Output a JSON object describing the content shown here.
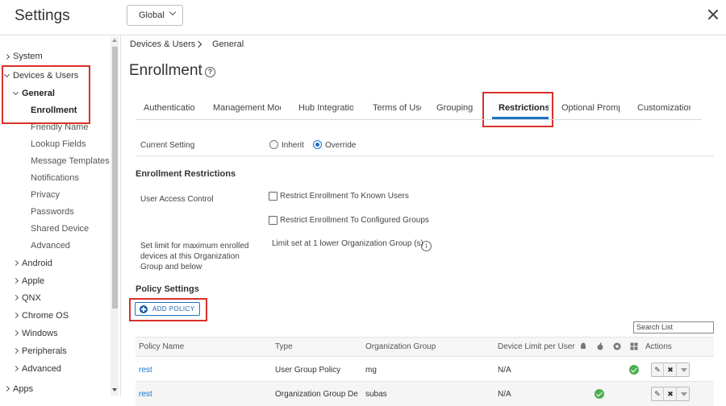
{
  "app": {
    "title": "Settings",
    "scope": "Global"
  },
  "sidebar": {
    "items": [
      {
        "label": "System"
      },
      {
        "label": "Devices & Users"
      },
      {
        "label": "General"
      },
      {
        "label": "Enrollment"
      },
      {
        "label": "Friendly Name"
      },
      {
        "label": "Lookup Fields"
      },
      {
        "label": "Message Templates"
      },
      {
        "label": "Notifications"
      },
      {
        "label": "Privacy"
      },
      {
        "label": "Passwords"
      },
      {
        "label": "Shared Device"
      },
      {
        "label": "Advanced"
      },
      {
        "label": "Android"
      },
      {
        "label": "Apple"
      },
      {
        "label": "QNX"
      },
      {
        "label": "Chrome OS"
      },
      {
        "label": "Windows"
      },
      {
        "label": "Peripherals"
      },
      {
        "label": "Advanced"
      },
      {
        "label": "Apps"
      }
    ]
  },
  "breadcrumb": {
    "parent": "Devices & Users",
    "current": "General"
  },
  "page": {
    "title": "Enrollment",
    "help_icon": "?"
  },
  "tabs": [
    {
      "label": "Authentication"
    },
    {
      "label": "Management Mode"
    },
    {
      "label": "Hub Integration"
    },
    {
      "label": "Terms of Use"
    },
    {
      "label": "Grouping"
    },
    {
      "label": "Restrictions"
    },
    {
      "label": "Optional Prompt"
    },
    {
      "label": "Customization"
    }
  ],
  "form": {
    "current_setting_label": "Current Setting",
    "inherit_label": "Inherit",
    "override_label": "Override",
    "selected": "Override",
    "enrollment_restrictions_heading": "Enrollment Restrictions",
    "user_access_control_label": "User Access Control",
    "restrict_known_users": "Restrict Enrollment To Known Users",
    "restrict_configured_groups": "Restrict Enrollment To Configured Groups",
    "limit_label_line1": "Set limit for maximum enrolled",
    "limit_label_line2": "devices at this Organization",
    "limit_label_line3": "Group and below",
    "limit_value": "Limit set at 1 lower Organization Group (s)",
    "info_icon": "i"
  },
  "policy": {
    "heading": "Policy Settings",
    "add_button": "ADD POLICY",
    "search_placeholder": "Search List",
    "columns": {
      "name": "Policy Name",
      "type": "Type",
      "org_group": "Organization Group",
      "device_limit": "Device Limit per User",
      "actions": "Actions"
    },
    "rows": [
      {
        "name": "rest",
        "type": "User Group Policy",
        "org_group": "mg",
        "device_limit": "N/A"
      },
      {
        "name": "rest",
        "type": "Organization Group De",
        "org_group": "subas",
        "device_limit": "N/A"
      }
    ]
  },
  "colors": {
    "accent": "#1a73c7",
    "highlight": "#d9302a",
    "success": "#4caf50"
  }
}
